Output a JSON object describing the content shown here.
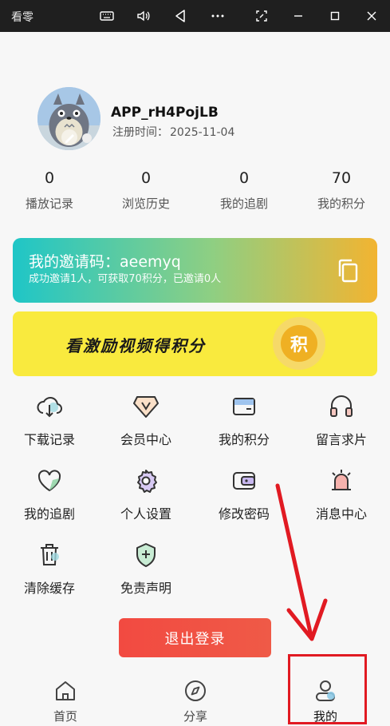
{
  "window": {
    "title": "看零",
    "controls": [
      "keyboard-icon",
      "volume-icon",
      "back-triangle-icon",
      "more-icon",
      "screenshot-icon",
      "minimize-icon",
      "maximize-icon",
      "close-icon"
    ]
  },
  "profile": {
    "username": "APP_rH4PojLB",
    "reg_label": "注册时间：",
    "reg_date": "2025-11-04"
  },
  "stats": [
    {
      "value": "0",
      "label": "播放记录"
    },
    {
      "value": "0",
      "label": "浏览历史"
    },
    {
      "value": "0",
      "label": "我的追剧"
    },
    {
      "value": "70",
      "label": "我的积分"
    }
  ],
  "invite": {
    "label": "我的邀请码：",
    "code": "aeemyq",
    "subtitle": "成功邀请1人，可获取70积分，已邀请0人",
    "colors": [
      "#1fc6c7",
      "#8fcf82",
      "#f2b431"
    ]
  },
  "reward": {
    "text": "看激励视频得积分",
    "coin_char": "积"
  },
  "grid": [
    {
      "label": "下载记录",
      "icon": "download-cloud-icon"
    },
    {
      "label": "会员中心",
      "icon": "vip-badge-icon"
    },
    {
      "label": "我的积分",
      "icon": "wallet-icon"
    },
    {
      "label": "留言求片",
      "icon": "headphones-icon"
    },
    {
      "label": "我的追剧",
      "icon": "heart-icon"
    },
    {
      "label": "个人设置",
      "icon": "gear-icon"
    },
    {
      "label": "修改密码",
      "icon": "key-wallet-icon"
    },
    {
      "label": "消息中心",
      "icon": "alarm-bell-icon"
    },
    {
      "label": "清除缓存",
      "icon": "trash-icon"
    },
    {
      "label": "免责声明",
      "icon": "shield-plus-icon"
    }
  ],
  "logout": {
    "label": "退出登录"
  },
  "nav": [
    {
      "label": "首页",
      "icon": "home-icon"
    },
    {
      "label": "分享",
      "icon": "compass-icon"
    },
    {
      "label": "我的",
      "icon": "user-icon"
    }
  ],
  "annotation": {
    "color": "#e11a22"
  }
}
